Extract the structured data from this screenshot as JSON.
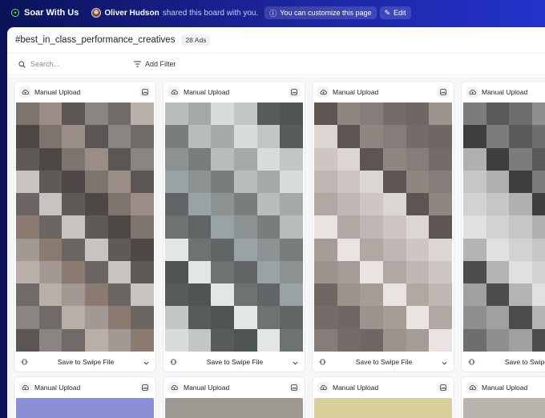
{
  "topbar": {
    "brand": "Soar With Us",
    "owner": "Oliver Hudson",
    "shared_text": "shared this board with you.",
    "customize_text": "You can customize this page",
    "edit_label": "Edit"
  },
  "board": {
    "title": "#best_in_class_performance_creatives",
    "count": "28 Ads",
    "search_placeholder": "Search...",
    "add_filter": "Add Filter"
  },
  "cards": [
    {
      "source": "Manual Upload",
      "save_label": "Save to Swipe File",
      "palette": [
        "#7d746e",
        "#b9aea8",
        "#5f5a58",
        "#8a8583",
        "#6b6664",
        "#9a8d85",
        "#a29894",
        "#4d4846",
        "#706b69",
        "#c8c3c1",
        "#5b5654",
        "#8b7a70"
      ]
    },
    {
      "source": "Manual Upload",
      "save_label": "Save to Swipe File",
      "palette": [
        "#9aa3a4",
        "#d8dcdc",
        "#6d7272",
        "#b7bcbd",
        "#4f5454",
        "#8d9293",
        "#c2c6c7",
        "#616566",
        "#a4a9aa",
        "#e3e6e6",
        "#787d7e",
        "#575b5c"
      ]
    },
    {
      "source": "Manual Upload",
      "save_label": "Save to Swipe File",
      "palette": [
        "#a59c98",
        "#dcd6d3",
        "#6e6764",
        "#bfb7b3",
        "#857d79",
        "#e9e4e1",
        "#5c5552",
        "#9c938f",
        "#cdc6c2",
        "#746c68",
        "#b1a8a4",
        "#8f8682"
      ]
    },
    {
      "source": "Manual Upload",
      "save_label": "Save to Swipe File",
      "palette": [
        "#8f8f8f",
        "#d2d2d2",
        "#5a5a5a",
        "#b4b4b4",
        "#3e3e3e",
        "#a0a0a0",
        "#c6c6c6",
        "#6e6e6e",
        "#e0e0e0",
        "#7c7c7c",
        "#4c4c4c",
        "#b0b0b0"
      ]
    }
  ],
  "second_row": [
    {
      "source": "Manual Upload",
      "color": "#8a8fd6"
    },
    {
      "source": "Manual Upload",
      "color": "#9d9892"
    },
    {
      "source": "Manual Upload",
      "color": "#d8cf9a"
    },
    {
      "source": "Manual Upload",
      "color": "#b9b4ae"
    }
  ]
}
